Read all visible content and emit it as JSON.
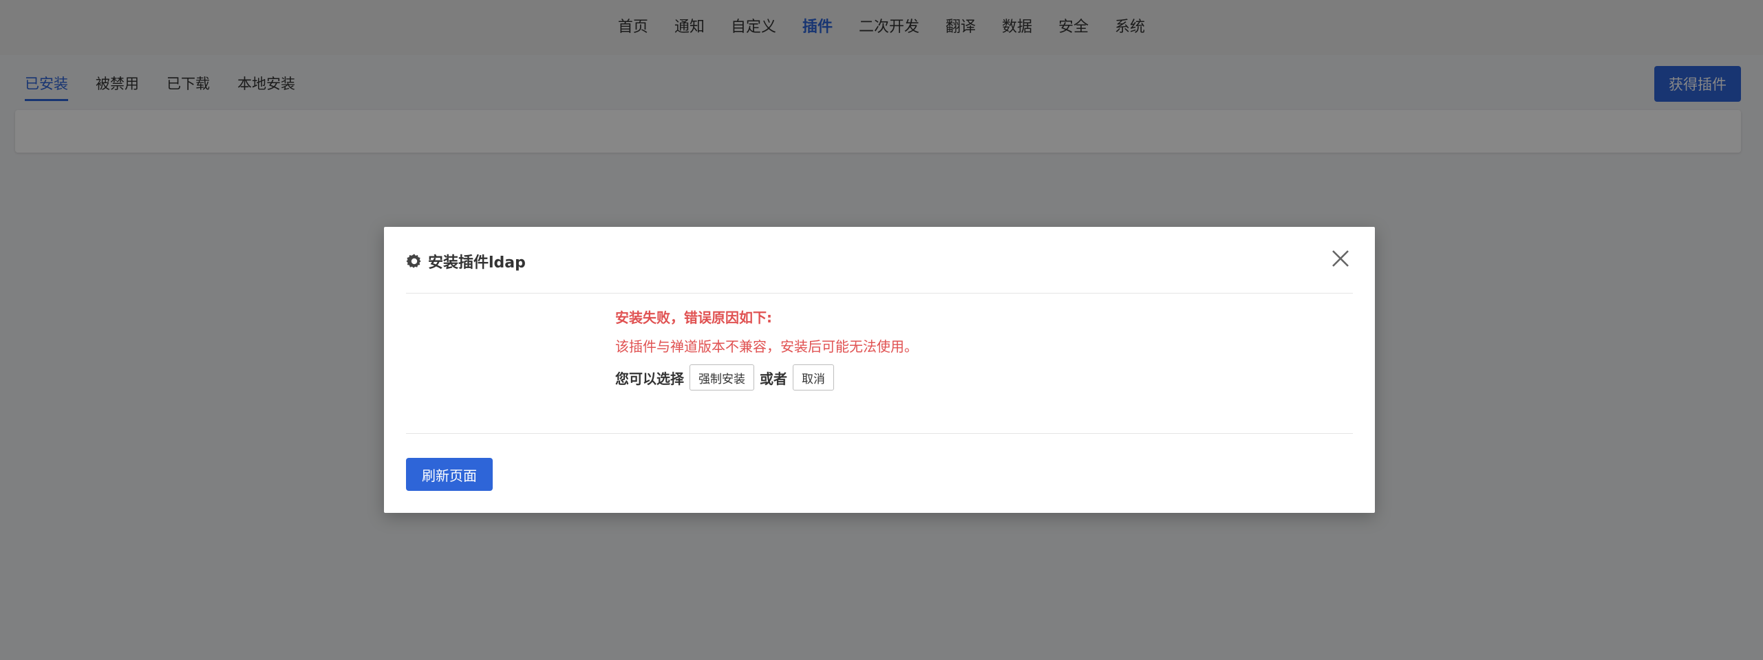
{
  "topnav": {
    "items": [
      "首页",
      "通知",
      "自定义",
      "插件",
      "二次开发",
      "翻译",
      "数据",
      "安全",
      "系统"
    ],
    "active_index": 3
  },
  "subtabs": {
    "items": [
      "已安装",
      "被禁用",
      "已下载",
      "本地安装"
    ],
    "active_index": 0
  },
  "header_actions": {
    "get_plugin_label": "获得插件"
  },
  "modal": {
    "title": "安装插件ldap",
    "title_icon": "gear-icon",
    "close_icon": "close-icon",
    "error_title": "安装失败，错误原因如下:",
    "error_detail": "该插件与禅道版本不兼容，安装后可能无法使用。",
    "choice_prefix": "您可以选择",
    "force_install_label": "强制安装",
    "choice_or": "或者",
    "cancel_label": "取消",
    "refresh_label": "刷新页面"
  },
  "colors": {
    "accent": "#2e65d8",
    "error": "#e05252",
    "overlay": "rgba(0,0,0,0.47)"
  }
}
